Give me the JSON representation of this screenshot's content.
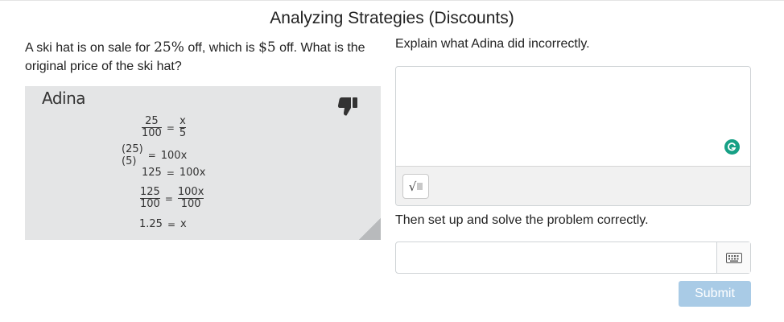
{
  "title": "Analyzing Strategies (Discounts)",
  "question": {
    "text_1": "A ski hat is on sale for ",
    "percent": "25%",
    "text_2": " off, which is ",
    "amount": "$5",
    "text_3": " off. What is the original price of the ski hat?"
  },
  "student_card": {
    "name": "Adina",
    "icon": "thumbs-down-icon",
    "steps": {
      "s1_left_num": "25",
      "s1_left_den": "100",
      "s1_eq": "=",
      "s1_right_num": "x",
      "s1_right_den": "5",
      "s2_left": "(25)(5)",
      "s2_eq": "=",
      "s2_right": "100x",
      "s3_left": "125",
      "s3_eq": "=",
      "s3_right": "100x",
      "s4_left_num": "125",
      "s4_left_den": "100",
      "s4_eq": "=",
      "s4_right_num": "100x",
      "s4_right_den": "100",
      "s5_left": "1.25",
      "s5_eq": "=",
      "s5_right": "x"
    }
  },
  "explain_prompt": "Explain what Adina did incorrectly.",
  "explain_value": "",
  "math_button_label": "√",
  "solve_prompt": "Then set up and solve the problem correctly.",
  "solve_value": "",
  "submit_label": "Submit",
  "colors": {
    "submit_bg": "#a9cbe6",
    "card_bg": "#e4e5e6",
    "grammarly": "#16a085"
  }
}
